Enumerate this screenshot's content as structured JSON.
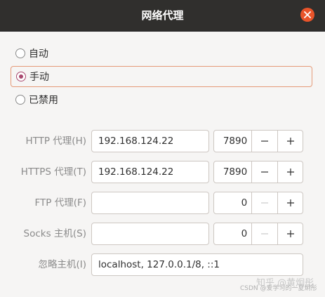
{
  "window": {
    "title": "网络代理"
  },
  "modes": [
    {
      "label": "自动",
      "selected": false
    },
    {
      "label": "手动",
      "selected": true
    },
    {
      "label": "已禁用",
      "selected": false
    }
  ],
  "proxies": [
    {
      "label": "HTTP 代理(H)",
      "host": "192.168.124.22",
      "port": "7890",
      "minus_enabled": true
    },
    {
      "label": "HTTPS 代理(T)",
      "host": "192.168.124.22",
      "port": "7890",
      "minus_enabled": true
    },
    {
      "label": "FTP 代理(F)",
      "host": "",
      "port": "0",
      "minus_enabled": false
    },
    {
      "label": "Socks 主机(S)",
      "host": "",
      "port": "0",
      "minus_enabled": false
    }
  ],
  "ignore": {
    "label": "忽略主机(I)",
    "value": "localhost, 127.0.0.1/8, ::1"
  },
  "watermark": {
    "line1": "知乎 @黄炯彤",
    "line2": "CSDN @爱学习的一夏炯彤"
  },
  "colors": {
    "accent": "#e9542a",
    "radio_checked": "#a8486f",
    "titlebar": "#302f2d"
  }
}
